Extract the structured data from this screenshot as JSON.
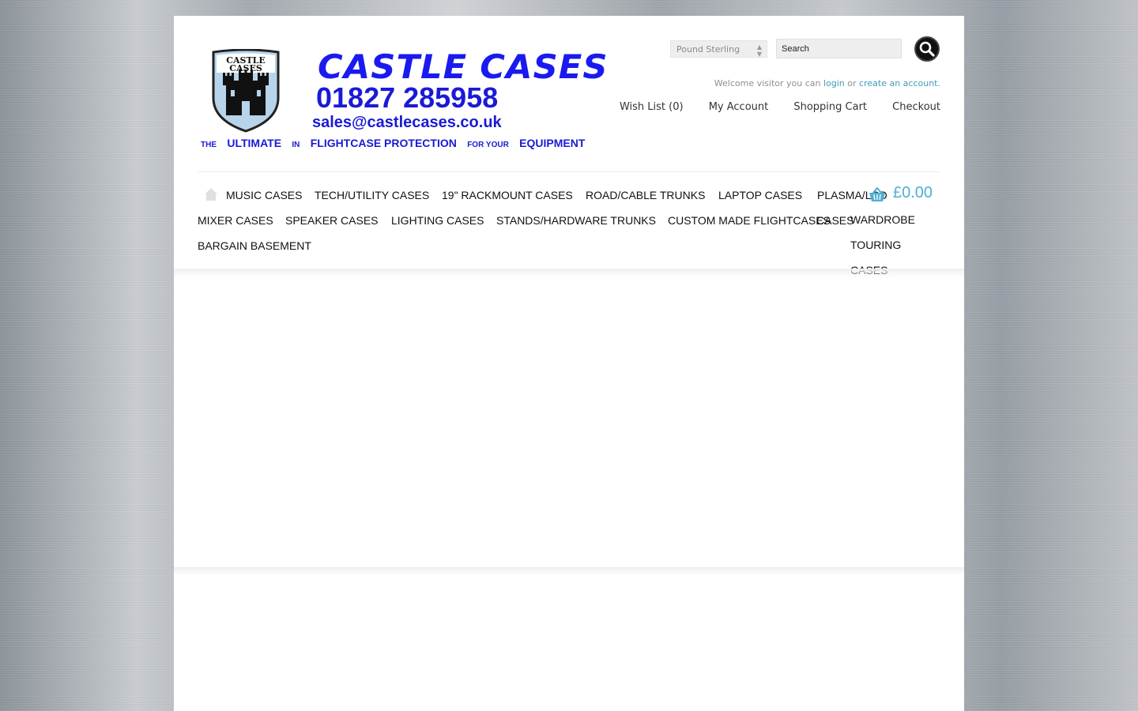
{
  "logo": {
    "crest_text_line1": "CASTLE",
    "crest_text_line2": "CASES",
    "name": "CASTLE CASES",
    "phone": "01827 285958",
    "email": "sales@castlecases.co.uk",
    "tagline": [
      "THE",
      "ULTIMATE",
      "IN",
      "FLIGHTCASE PROTECTION",
      "FOR YOUR",
      "EQUIPMENT"
    ]
  },
  "header": {
    "currency": "Pound Sterling",
    "search_value": "Search",
    "welcome_prefix": "Welcome visitor you can",
    "login": "login",
    "or": "or",
    "create_account": "create an account.",
    "links": [
      "Wish List (0)",
      "My Account",
      "Shopping Cart",
      "Checkout"
    ]
  },
  "menu": {
    "items": [
      "MUSIC CASES",
      "TECH/UTILITY CASES",
      "19\" RACKMOUNT CASES",
      "ROAD/CABLE TRUNKS",
      "LAPTOP CASES",
      "PLASMA/LCD",
      "MIXER CASES",
      "SPEAKER CASES",
      "LIGHTING CASES",
      "STANDS/HARDWARE TRUNKS",
      "CUSTOM MADE FLIGHTCASES",
      "CASES",
      "BARGAIN BASEMENT"
    ],
    "wardrobe_lines": [
      "WARDROBE",
      "TOURING",
      "CASES"
    ]
  },
  "cart": {
    "total": "£0.00",
    "icon": "basket-icon"
  },
  "colors": {
    "brand_blue": "#1a1ad6",
    "link_blue": "#3f9bbd",
    "cart_blue": "#4cb0d3"
  }
}
